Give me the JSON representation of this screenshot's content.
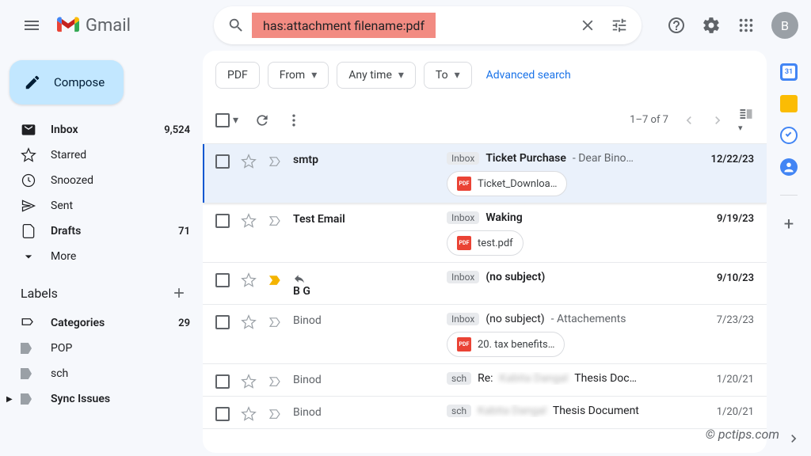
{
  "app": {
    "name": "Gmail",
    "avatar_initial": "B"
  },
  "search": {
    "query": "has:attachment filename:pdf"
  },
  "compose": {
    "label": "Compose"
  },
  "nav": [
    {
      "label": "Inbox",
      "count": "9,524",
      "bold": true
    },
    {
      "label": "Starred",
      "count": ""
    },
    {
      "label": "Snoozed",
      "count": ""
    },
    {
      "label": "Sent",
      "count": ""
    },
    {
      "label": "Drafts",
      "count": "71",
      "bold": true
    },
    {
      "label": "More",
      "count": ""
    }
  ],
  "labels_header": "Labels",
  "labels": [
    {
      "label": "Categories",
      "count": "29",
      "bold": true
    },
    {
      "label": "POP",
      "count": ""
    },
    {
      "label": "sch",
      "count": ""
    },
    {
      "label": "Sync Issues",
      "count": "",
      "bold": true
    }
  ],
  "chips": {
    "c1": "PDF",
    "c2": "From",
    "c3": "Any time",
    "c4": "To",
    "advanced": "Advanced search"
  },
  "toolbar": {
    "pagination": "1–7 of 7"
  },
  "emails": [
    {
      "sender": "smtp",
      "tag": "Inbox",
      "subject": "Ticket Purchase",
      "snippet": " - Dear Bino…",
      "date": "12/22/23",
      "attachment": "Ticket_Downloa…",
      "bold": true,
      "selected": true
    },
    {
      "sender": "Test Email",
      "tag": "Inbox",
      "subject": "Waking",
      "snippet": "",
      "date": "9/19/23",
      "attachment": "test.pdf",
      "bold": true
    },
    {
      "sender": "B G",
      "tag": "Inbox",
      "subject": "(no subject)",
      "snippet": "",
      "date": "9/10/23",
      "bold": true,
      "reply": true,
      "important": true
    },
    {
      "sender": "Binod",
      "tag": "Inbox",
      "subject": "(no subject)",
      "snippet": " - Attachements",
      "date": "7/23/23",
      "attachment": "20. tax benefits…"
    },
    {
      "sender": "Binod",
      "tag": "sch",
      "subject_prefix": "Re:",
      "subject_blur": "Kabita Dangal",
      "subject_suffix": " Thesis Doc…",
      "date": "1/20/21"
    },
    {
      "sender": "Binod",
      "tag": "sch",
      "subject_blur": "Kabita Dangal",
      "subject_suffix": " Thesis Document",
      "date": "1/20/21"
    }
  ],
  "watermark": "© pctips.com"
}
